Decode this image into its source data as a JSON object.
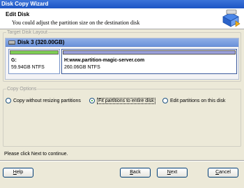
{
  "window": {
    "title": "Disk Copy Wizard"
  },
  "header": {
    "title": "Edit Disk",
    "subtitle": "You could adjust the partition size on the destination disk"
  },
  "target_layout": {
    "legend": "Target Disk Layout",
    "disk_name": "Disk 3 (320.00GB)",
    "partitions": [
      {
        "label": "G:",
        "size": "59.94GB NTFS",
        "bar_color": "#7fce54"
      },
      {
        "label": "H:www.partition-magic-server.com",
        "size": "260.06GB NTFS",
        "bar_color": "#9a9fd9"
      }
    ]
  },
  "copy_options": {
    "legend": "Copy Options",
    "options": [
      {
        "label": "Copy without resizing partitions",
        "checked": false
      },
      {
        "label": "Fit partitions to entire disk",
        "checked": true
      },
      {
        "label": "Edit partitions on this disk",
        "checked": false
      }
    ]
  },
  "status": "Please click Next to continue.",
  "buttons": {
    "help": {
      "first": "H",
      "rest": "elp"
    },
    "back": {
      "first": "B",
      "rest": "ack"
    },
    "next": {
      "first": "N",
      "rest": "ext"
    },
    "cancel": {
      "first": "C",
      "rest": "ancel"
    }
  }
}
